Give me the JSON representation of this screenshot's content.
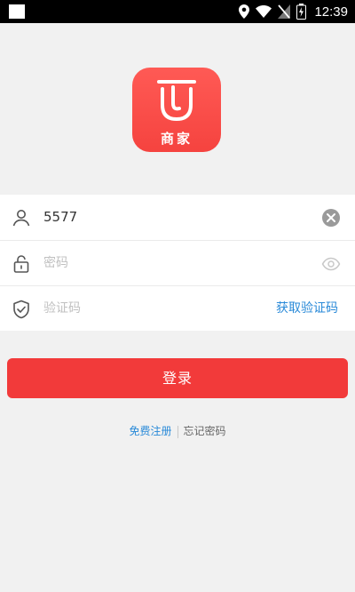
{
  "status_bar": {
    "time": "12:39"
  },
  "logo": {
    "text": "商家",
    "colors": {
      "gradient_top": "#ff5a55",
      "gradient_bottom": "#f5433f"
    }
  },
  "form": {
    "username": {
      "value": "5577",
      "icon": "user-icon",
      "clear_icon": "clear-icon"
    },
    "password": {
      "placeholder": "密码",
      "icon": "lock-icon",
      "toggle_icon": "eye-icon"
    },
    "code": {
      "placeholder": "验证码",
      "icon": "shield-check-icon",
      "get_code_label": "获取验证码"
    }
  },
  "login_button": {
    "label": "登录",
    "color": "#f23a3a"
  },
  "links": {
    "register": "免费注册",
    "forgot": "忘记密码"
  },
  "colors": {
    "accent_blue": "#2a8ad8",
    "background": "#f1f1f1"
  }
}
